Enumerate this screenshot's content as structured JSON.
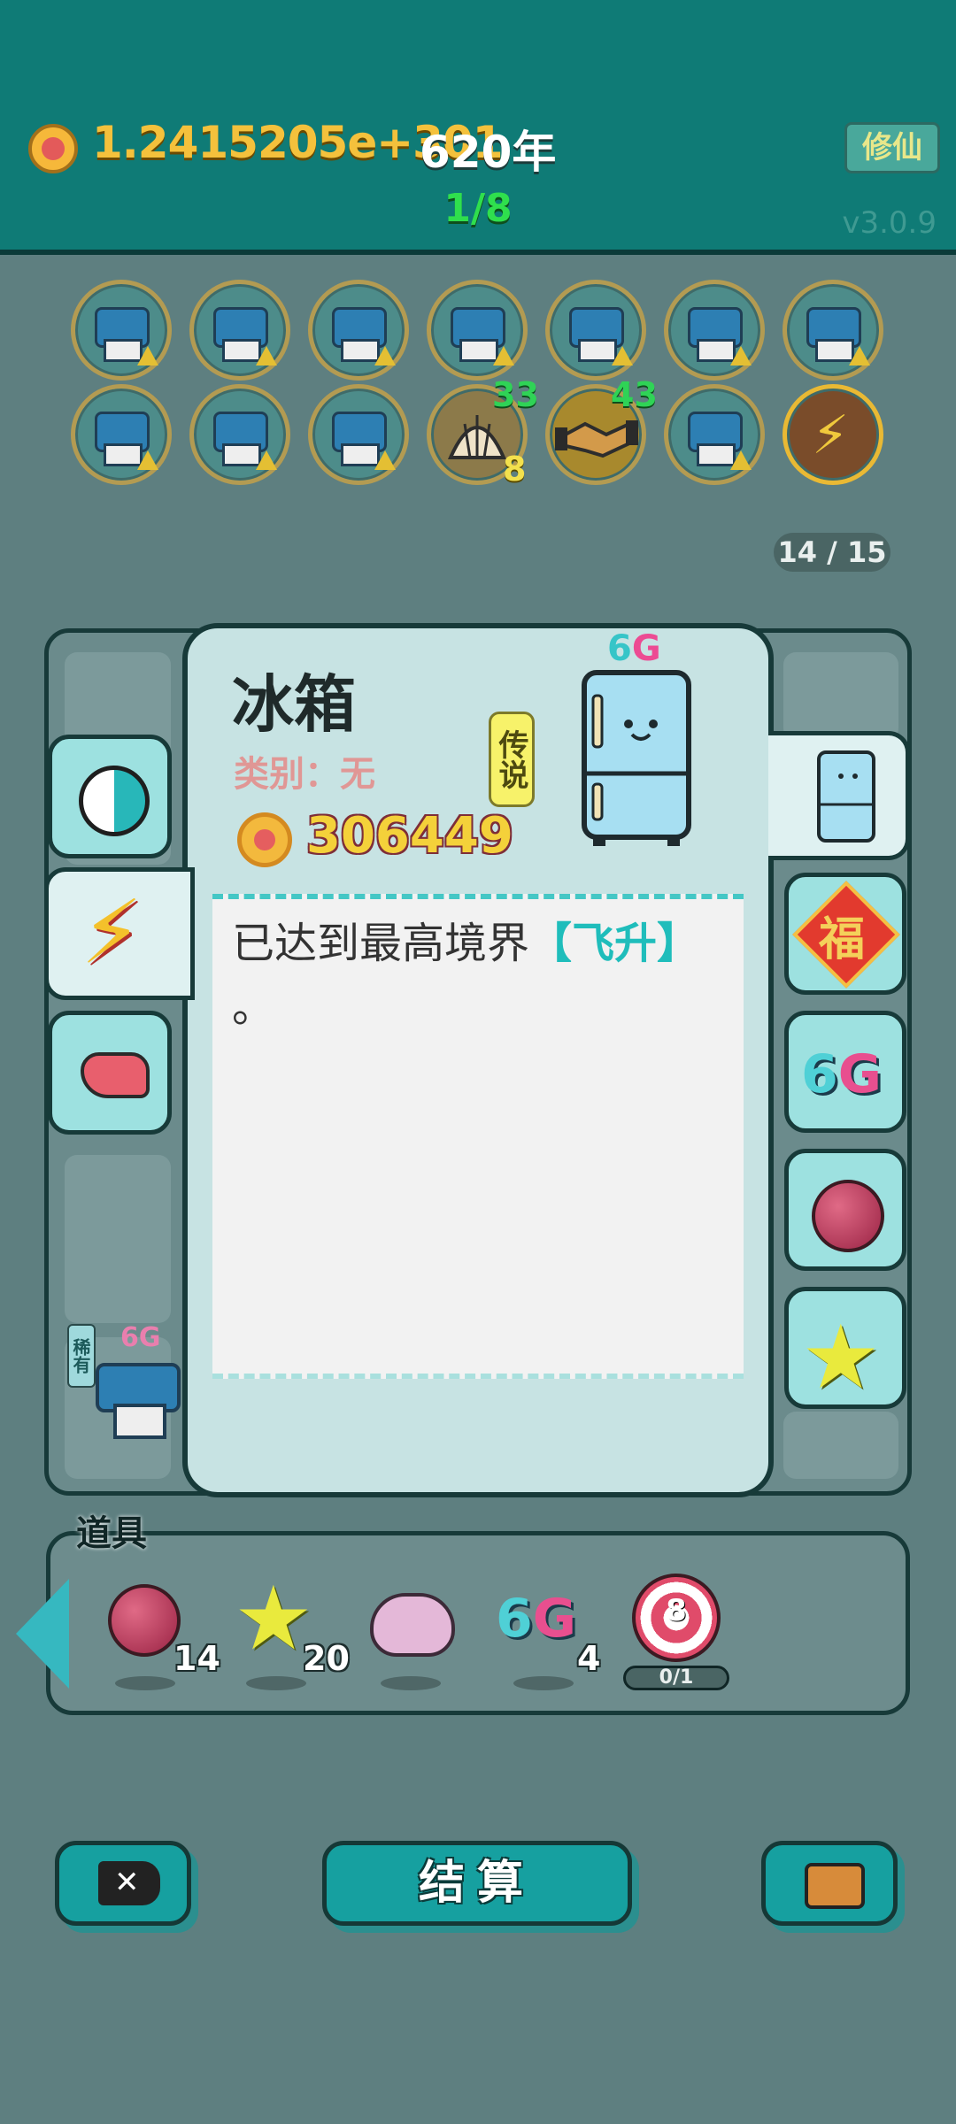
{
  "header": {
    "currency_value": "1.2415205e+301",
    "years": "620年",
    "mode_button": "修仙",
    "stage": "1/8",
    "version": "v3.0.9"
  },
  "relics": {
    "counter": "14 / 15",
    "shell_top": "33",
    "shell_bottom": "8",
    "handshake_top": "43"
  },
  "dialog": {
    "title": "冰箱",
    "category": "类别：无",
    "rarity": "传说",
    "price": "306449",
    "generation": "6",
    "generation_suffix": "G",
    "description_prefix": "已达到最高境界",
    "description_highlight": "【飞升】",
    "description_suffix": "。"
  },
  "tabs": {
    "right_fu": "福",
    "right_6g_num": "6",
    "right_6g_letter": "G"
  },
  "items": {
    "label": "道具",
    "bayberry_count": "14",
    "star_count": "20",
    "sixg_count": "4",
    "sixg_num": "6",
    "sixg_letter": "G",
    "target_number": "8",
    "target_progress": "0/1"
  },
  "buttons": {
    "settle": "结算"
  },
  "board": {
    "printer_badge": "6G",
    "printer_tag": "稀有"
  }
}
